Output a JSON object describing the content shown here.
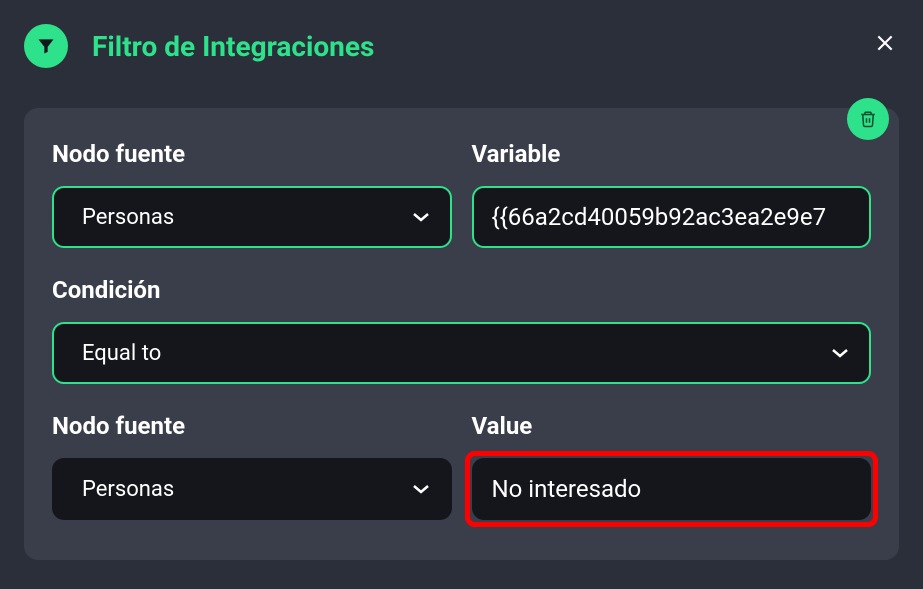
{
  "header": {
    "title": "Filtro de Integraciones"
  },
  "panel": {
    "row1": {
      "source_node": {
        "label": "Nodo fuente",
        "value": "Personas"
      },
      "variable": {
        "label": "Variable",
        "value": "{{66a2cd40059b92ac3ea2e9e7"
      }
    },
    "row2": {
      "condition": {
        "label": "Condición",
        "value": "Equal to"
      }
    },
    "row3": {
      "source_node": {
        "label": "Nodo fuente",
        "value": "Personas"
      },
      "value_field": {
        "label": "Value",
        "value": "No interesado"
      }
    }
  },
  "icons": {
    "filter": "filter-icon",
    "close": "close-icon",
    "trash": "trash-icon",
    "chevron": "chevron-down-icon"
  },
  "colors": {
    "accent": "#2de28a",
    "bg_dark": "#2b2f3a",
    "panel_bg": "#3a3e4a",
    "input_bg": "#14161c",
    "highlight": "#ff0000"
  }
}
